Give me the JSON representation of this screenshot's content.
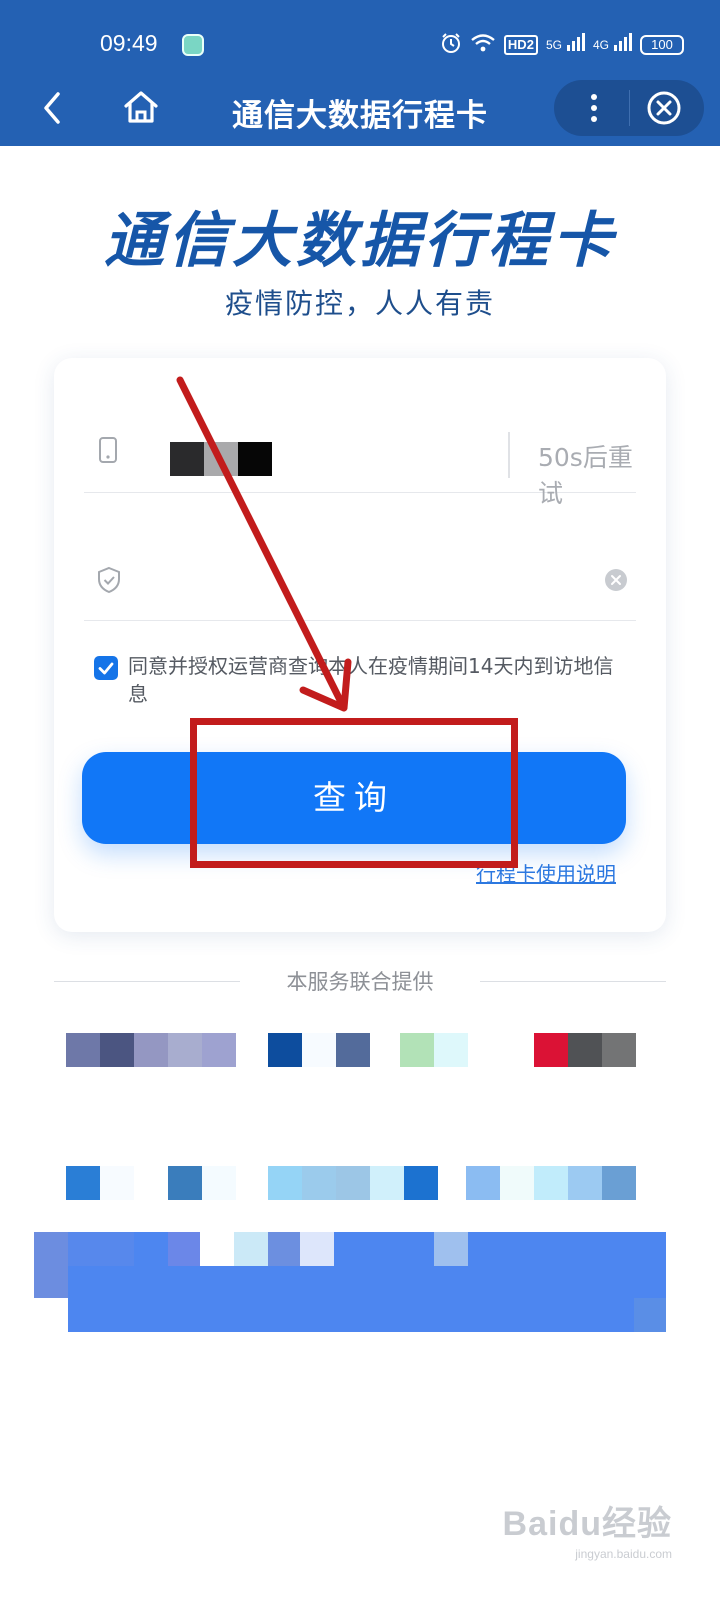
{
  "status_bar": {
    "time": "09:49",
    "network_tag": "HD2",
    "sim1": "5G",
    "sim2": "4G",
    "battery": "100"
  },
  "nav": {
    "title": "通信大数据行程卡"
  },
  "hero": {
    "title": "通信大数据行程卡",
    "subtitle": "疫情防控，人人有责"
  },
  "form": {
    "retry_label": "50s后重试",
    "code_value": "",
    "agreement": "同意并授权运营商查询本人在疫情期间14天内到访地信息",
    "agreement_checked": true,
    "query_button": "查询",
    "guide_link": "行程卡使用说明"
  },
  "footer": {
    "provided_by": "本服务联合提供"
  },
  "watermark": {
    "logo": "Baidu经验",
    "url": "jingyan.baidu.com"
  },
  "colors": {
    "topbar": "#2461b3",
    "primary_button": "#1177f7",
    "hero_title": "#1656a8",
    "annotation": "#c21c1c"
  }
}
